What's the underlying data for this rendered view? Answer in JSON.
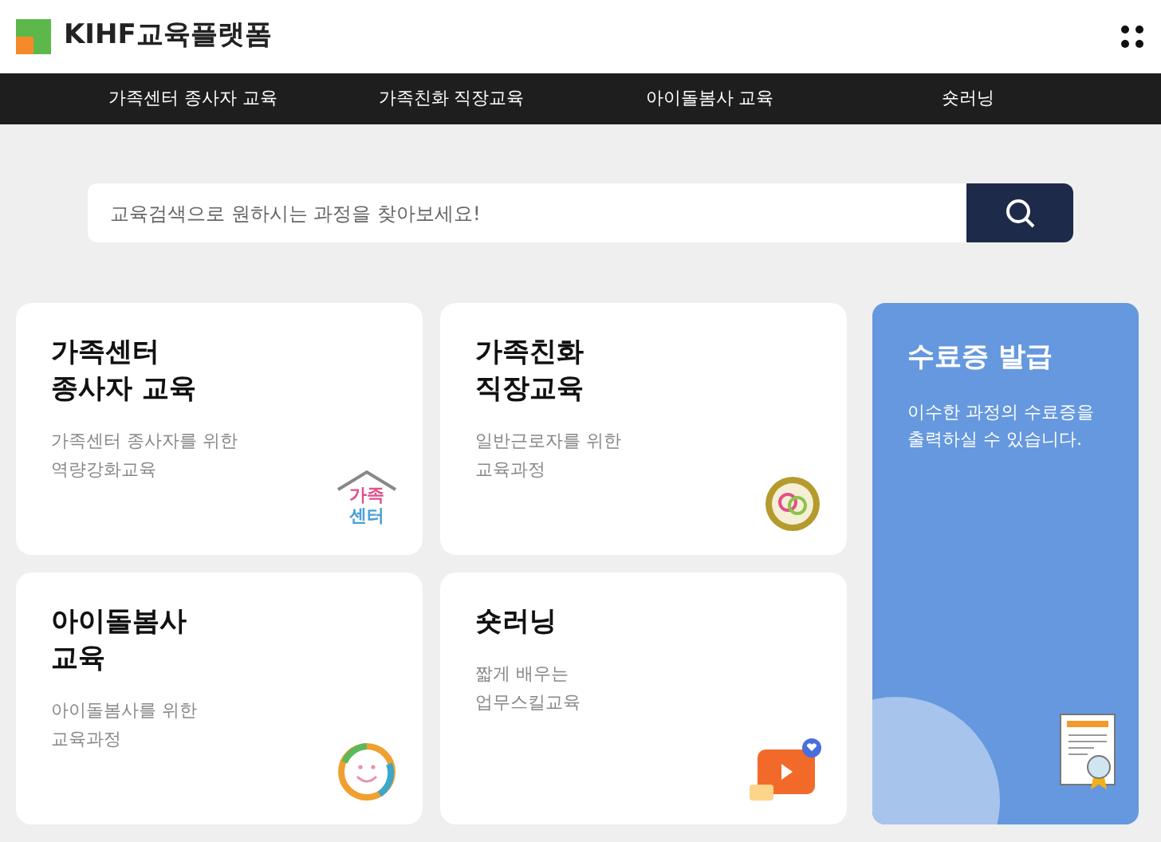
{
  "header": {
    "logo_text": "KIHF교육플랫폼"
  },
  "nav": {
    "items": [
      {
        "label": "가족센터 종사자 교육"
      },
      {
        "label": "가족친화 직장교육"
      },
      {
        "label": "아이돌봄사 교육"
      },
      {
        "label": "숏러닝"
      }
    ]
  },
  "search": {
    "placeholder": "교육검색으로 원하시는 과정을 찾아보세요!"
  },
  "cards": [
    {
      "kind": "house",
      "title": "가족센터\n종사자 교육",
      "description": "가족센터 종사자를 위한\n역량강화교육",
      "icon_lines": [
        "가족",
        "센터"
      ]
    },
    {
      "kind": "seal",
      "title": "가족친화\n직장교육",
      "description": "일반근로자를 위한\n교육과정"
    },
    {
      "kind": "smile",
      "title": "아이돌봄사\n교육",
      "description": "아이돌봄사를 위한\n교육과정"
    },
    {
      "kind": "video",
      "title": "숏러닝",
      "description": "짧게 배우는\n업무스킬교육"
    }
  ],
  "certificate": {
    "title": "수료증 발급",
    "description": "이수한 과정의 수료증을\n출력하실 수 있습니다."
  }
}
